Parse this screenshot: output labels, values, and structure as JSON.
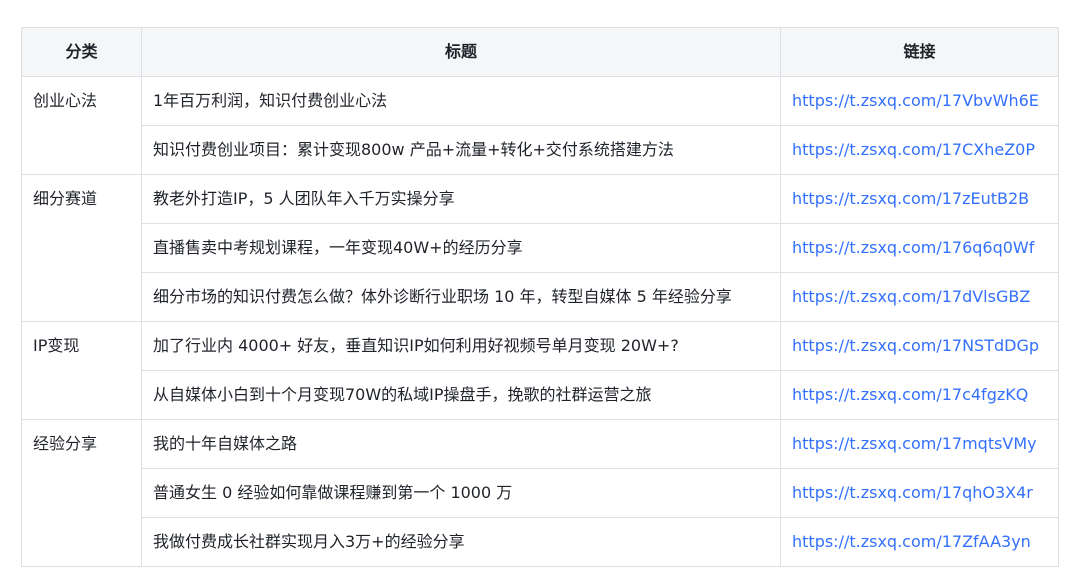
{
  "table": {
    "headers": [
      "分类",
      "标题",
      "链接"
    ],
    "groups": [
      {
        "category": "创业心法",
        "rows": [
          {
            "title": "1年百万利润，知识付费创业心法",
            "link": "https://t.zsxq.com/17VbvWh6E"
          },
          {
            "title": "知识付费创业项目：累计变现800w 产品+流量+转化+交付系统搭建方法",
            "link": "https://t.zsxq.com/17CXheZ0P"
          }
        ]
      },
      {
        "category": "细分赛道",
        "rows": [
          {
            "title": "教老外打造IP，5 人团队年入千万实操分享",
            "link": "https://t.zsxq.com/17zEutB2B"
          },
          {
            "title": "直播售卖中考规划课程，一年变现40W+的经历分享",
            "link": "https://t.zsxq.com/176q6q0Wf"
          },
          {
            "title": "细分市场的知识付费怎么做？体外诊断行业职场 10 年，转型自媒体 5 年经验分享",
            "link": "https://t.zsxq.com/17dVlsGBZ"
          }
        ]
      },
      {
        "category": "IP变现",
        "rows": [
          {
            "title": "加了行业内 4000+ 好友，垂直知识IP如何利用好视频号单月变现 20W+?",
            "link": "https://t.zsxq.com/17NSTdDGp"
          },
          {
            "title": "从自媒体小白到十个月变现70W的私域IP操盘手，挽歌的社群运营之旅",
            "link": "https://t.zsxq.com/17c4fgzKQ"
          }
        ]
      },
      {
        "category": "经验分享",
        "rows": [
          {
            "title": "我的十年自媒体之路",
            "link": "https://t.zsxq.com/17mqtsVMy"
          },
          {
            "title": "普通女生 0 经验如何靠做课程赚到第一个 1000 万",
            "link": "https://t.zsxq.com/17qhO3X4r"
          },
          {
            "title": "我做付费成长社群实现月入3万+的经验分享",
            "link": "https://t.zsxq.com/17ZfAA3yn"
          }
        ]
      }
    ]
  }
}
